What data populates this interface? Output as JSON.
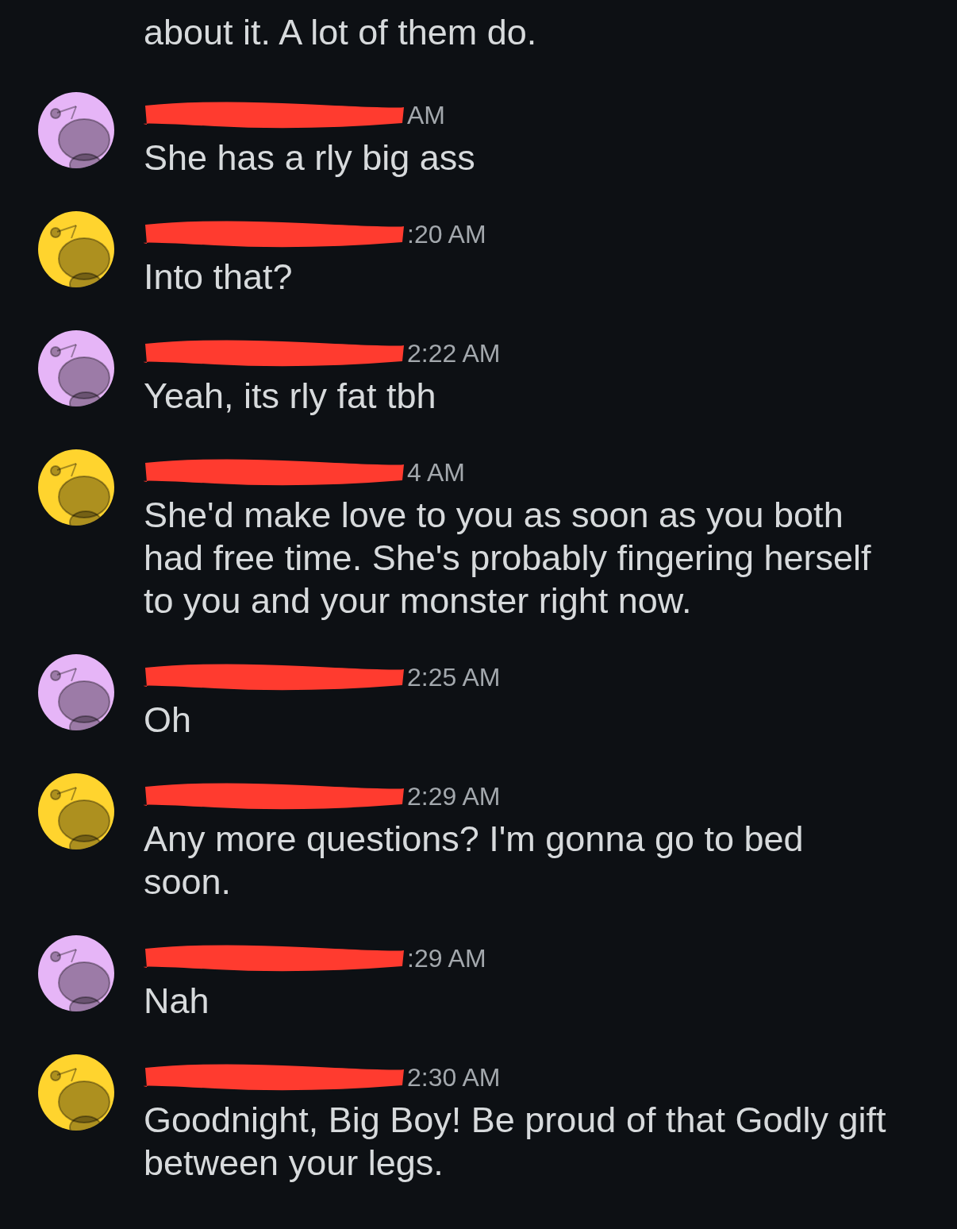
{
  "intro_text": "about it. A lot of them do.",
  "messages": [
    {
      "color": "#e6b5f7",
      "time": "AM",
      "text": "She has a rly big ass"
    },
    {
      "color": "#ffd42e",
      "time": ":20 AM",
      "text": "Into that?"
    },
    {
      "color": "#e6b5f7",
      "time": "2:22 AM",
      "text": "Yeah, its rly fat tbh"
    },
    {
      "color": "#ffd42e",
      "time": "4 AM",
      "text": "She'd make love to you as soon as you both\nhad free time. She's probably fingering herself\nto you and your monster right now."
    },
    {
      "color": "#e6b5f7",
      "time": "2:25 AM",
      "text": "Oh"
    },
    {
      "color": "#ffd42e",
      "time": "2:29 AM",
      "text": "Any more questions? I'm gonna go to bed\nsoon."
    },
    {
      "color": "#e6b5f7",
      "time": ":29 AM",
      "text": "Nah"
    },
    {
      "color": "#ffd42e",
      "time": "2:30 AM",
      "text": "Goodnight, Big Boy! Be proud of that Godly gift\nbetween your legs."
    }
  ]
}
